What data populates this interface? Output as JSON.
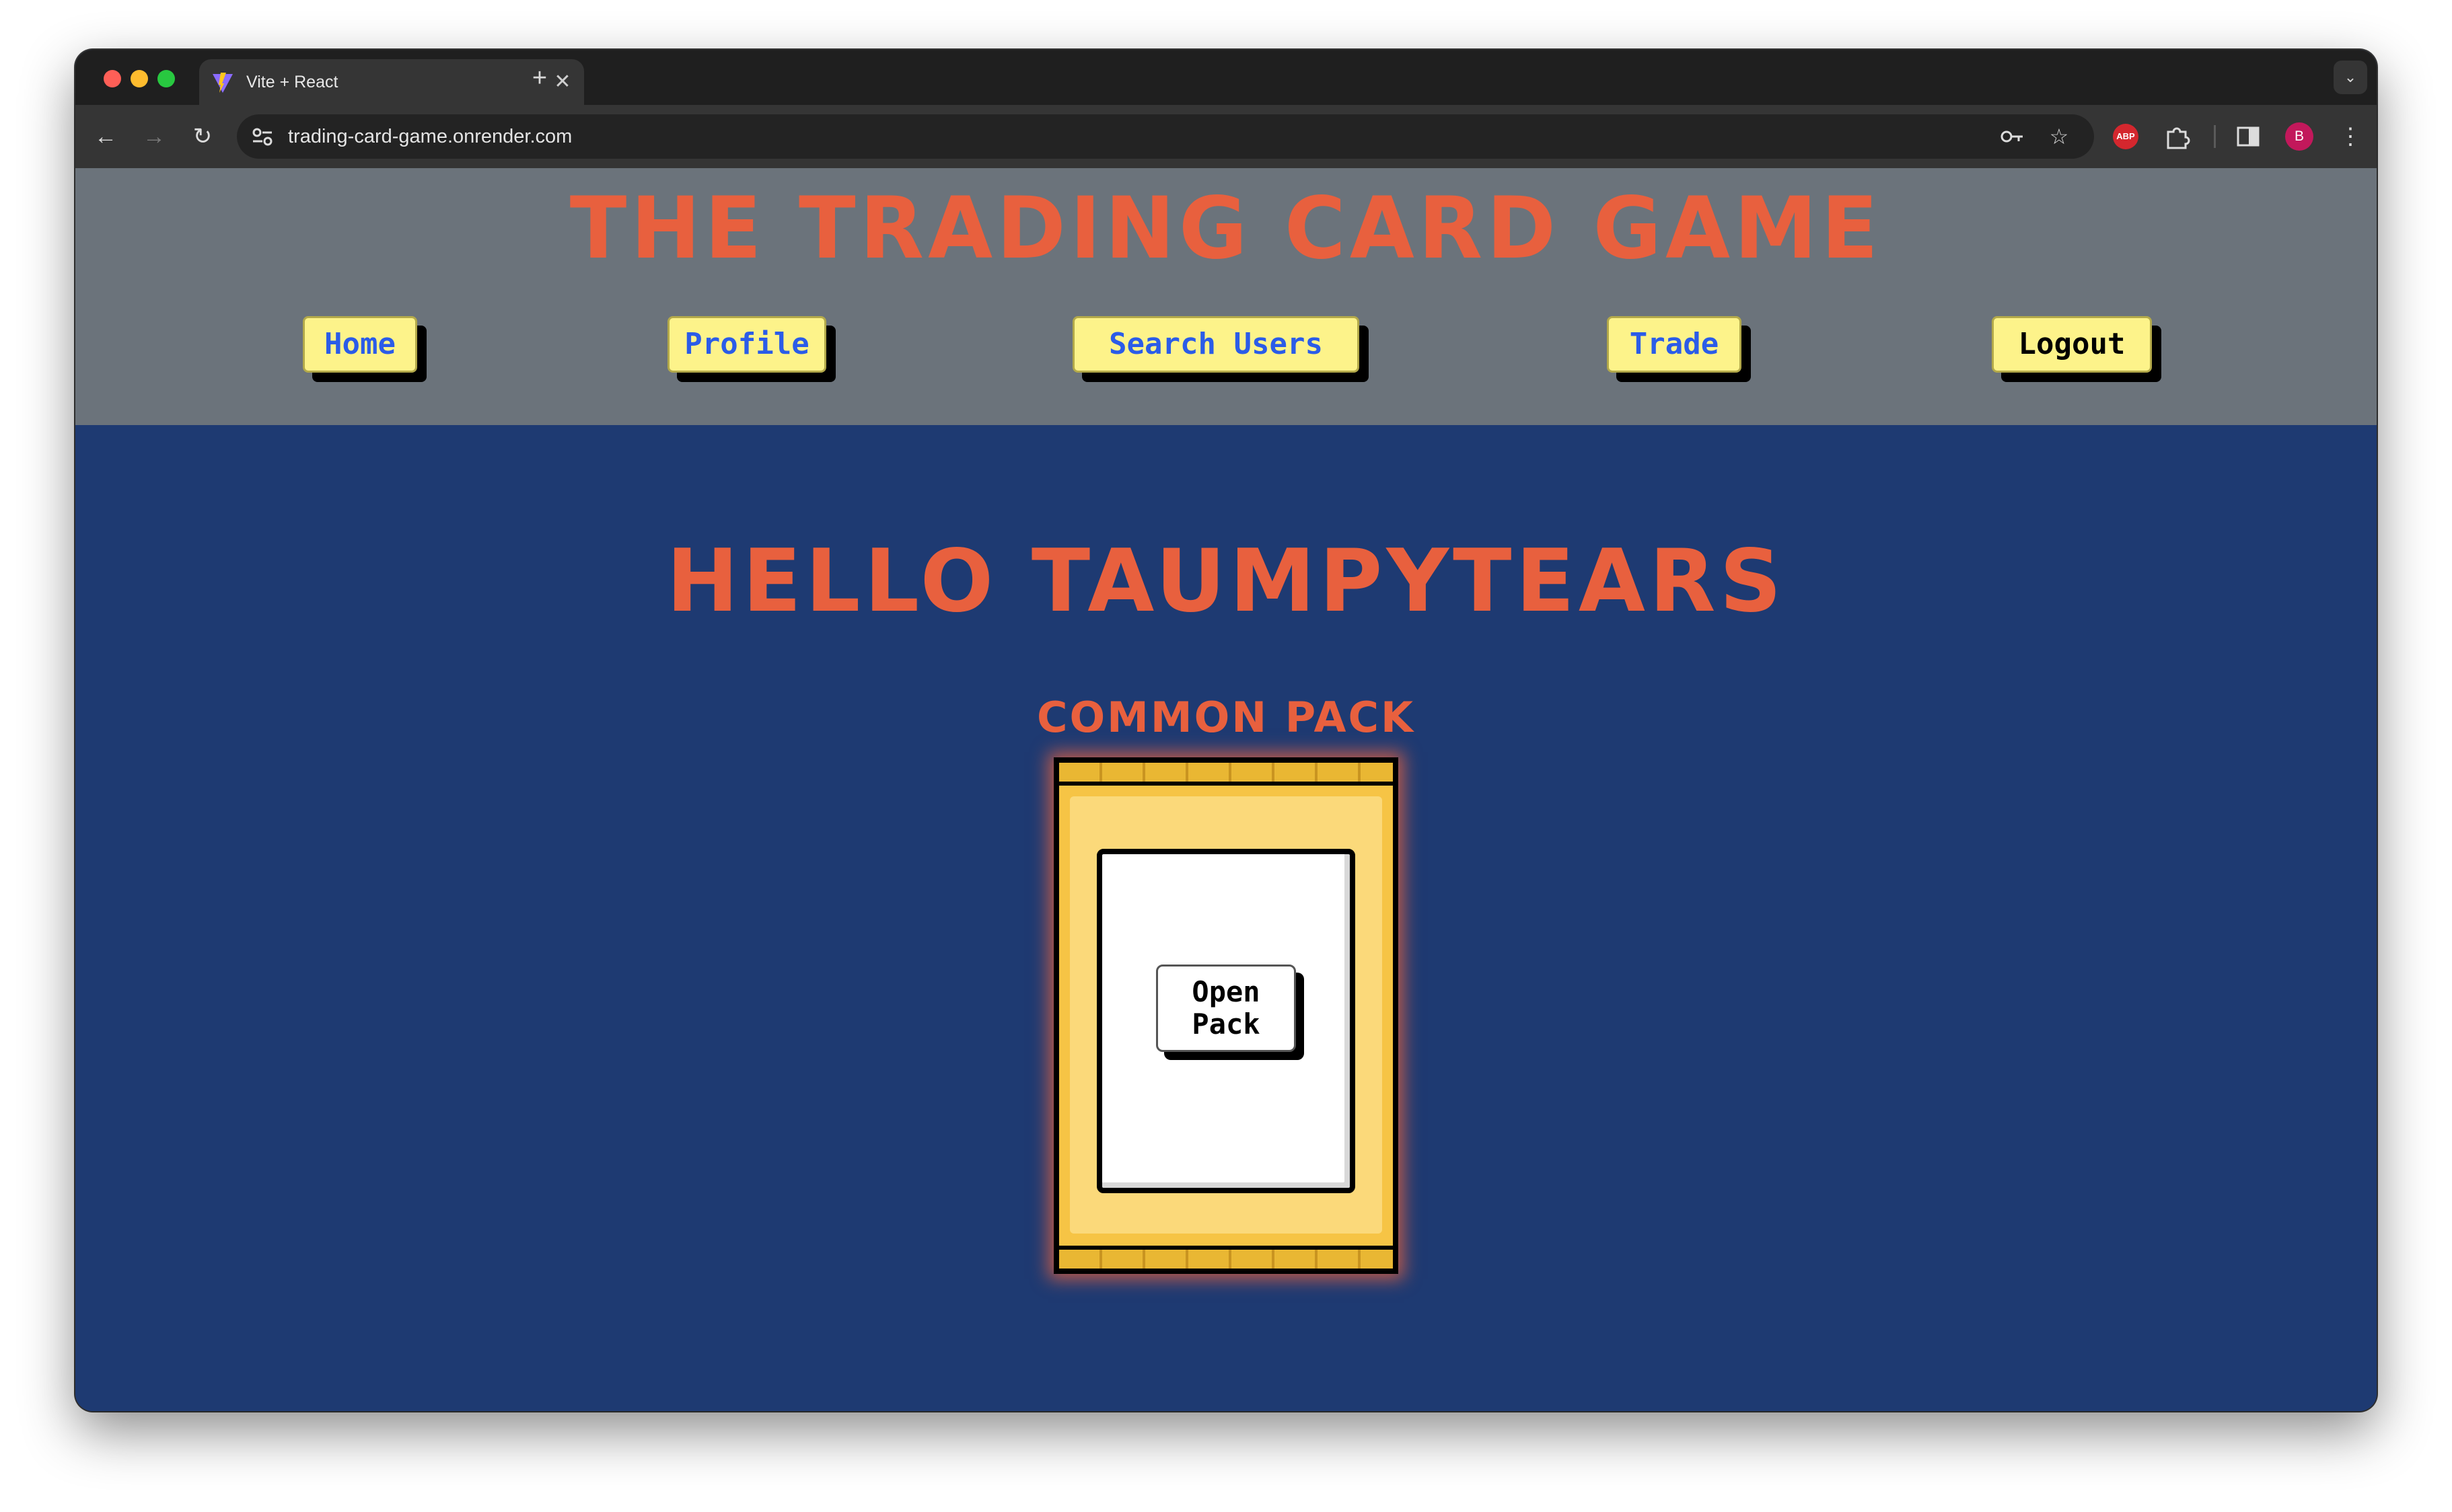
{
  "browser": {
    "tab_title": "Vite + React",
    "tab_close": "✕",
    "new_tab": "+",
    "url": "trading-card-game.onrender.com",
    "profile_initial": "B",
    "adblock_label": "ABP",
    "icons": [
      "back-icon",
      "forward-icon",
      "reload-icon",
      "site-settings-icon",
      "password-key-icon",
      "bookmark-star-icon",
      "adblock-icon",
      "extensions-icon",
      "side-panel-icon",
      "more-menu-icon",
      "tab-dropdown-icon"
    ]
  },
  "site": {
    "title": "The Trading Card Game",
    "nav": {
      "home": "Home",
      "profile": "Profile",
      "search_users": "Search Users",
      "trade": "Trade",
      "logout": "Logout"
    }
  },
  "main": {
    "greeting": "Hello taumpytears",
    "pack_title": "Common Pack",
    "open_pack_label": "Open\nPack"
  },
  "colors": {
    "header_bg": "#6b737b",
    "page_bg": "#1e3a72",
    "accent": "#e8603e",
    "nav_button_bg": "#fdf38a",
    "nav_text": "#2b5ce8",
    "pack_gold": "#f6c445"
  }
}
